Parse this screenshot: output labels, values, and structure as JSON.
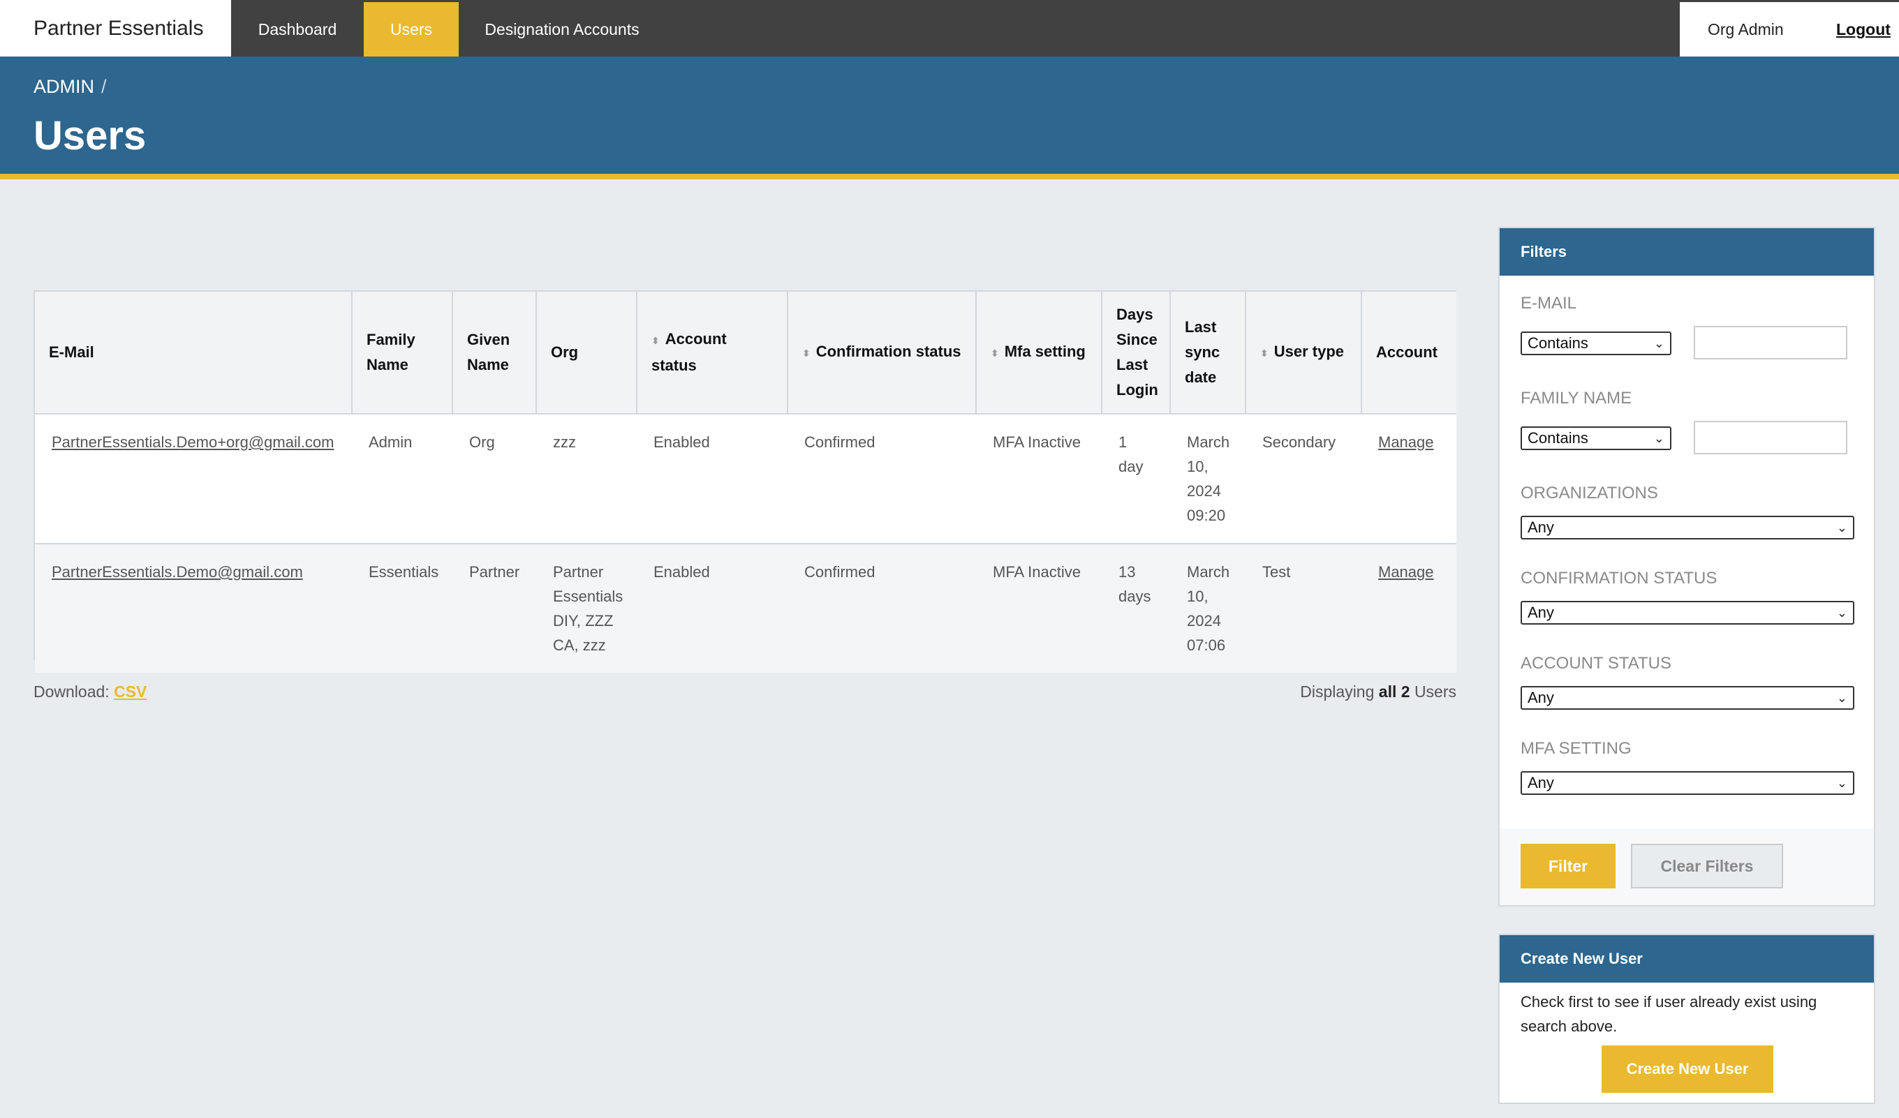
{
  "nav": {
    "brand": "Partner Essentials",
    "items": [
      {
        "label": "Dashboard"
      },
      {
        "label": "Users",
        "active": true
      },
      {
        "label": "Designation Accounts"
      }
    ],
    "org_admin": "Org Admin",
    "logout": "Logout"
  },
  "header": {
    "breadcrumb": "ADMIN",
    "breadcrumb_sep": "/",
    "title": "Users"
  },
  "table": {
    "columns": [
      {
        "label": "E-Mail",
        "sortable": false
      },
      {
        "label": "Family Name",
        "sortable": false
      },
      {
        "label": "Given Name",
        "sortable": false
      },
      {
        "label": "Org",
        "sortable": false
      },
      {
        "label": "Account status",
        "sortable": true
      },
      {
        "label": "Confirmation status",
        "sortable": true
      },
      {
        "label": "Mfa setting",
        "sortable": true
      },
      {
        "label": "Days Since Last Login",
        "sortable": false
      },
      {
        "label": "Last sync date",
        "sortable": false
      },
      {
        "label": "User type",
        "sortable": true
      },
      {
        "label": "Account",
        "sortable": false
      }
    ],
    "rows": [
      {
        "email": "PartnerEssentials.Demo+org@gmail.com",
        "family_name": "Admin",
        "given_name": "Org",
        "org": "zzz",
        "account_status": "Enabled",
        "confirmation_status": "Confirmed",
        "mfa_setting": "MFA Inactive",
        "days_since_login": "1 day",
        "last_sync": "March 10, 2024 09:20",
        "user_type": "Secondary",
        "account": "Manage"
      },
      {
        "email": "PartnerEssentials.Demo@gmail.com",
        "family_name": "Essentials",
        "given_name": "Partner",
        "org": "Partner Essentials DIY, ZZZ CA, zzz",
        "account_status": "Enabled",
        "confirmation_status": "Confirmed",
        "mfa_setting": "MFA Inactive",
        "days_since_login": "13 days",
        "last_sync": "March 10, 2024 07:06",
        "user_type": "Test",
        "account": "Manage"
      }
    ]
  },
  "footer": {
    "download_label": "Download:",
    "download_link": "CSV",
    "displaying_prefix": "Displaying",
    "displaying_count": "all 2",
    "displaying_suffix": "Users"
  },
  "filters": {
    "title": "Filters",
    "email_label": "E-MAIL",
    "email_mode": "Contains",
    "email_value": "",
    "family_label": "FAMILY NAME",
    "family_mode": "Contains",
    "family_value": "",
    "org_label": "ORGANIZATIONS",
    "org_value": "Any",
    "confirmation_label": "CONFIRMATION STATUS",
    "confirmation_value": "Any",
    "account_label": "ACCOUNT STATUS",
    "account_value": "Any",
    "mfa_label": "MFA SETTING",
    "mfa_value": "Any",
    "filter_button": "Filter",
    "clear_button": "Clear Filters"
  },
  "create_user": {
    "title": "Create New User",
    "text": "Check first to see if user already exist using search above.",
    "button": "Create New User"
  },
  "colors": {
    "nav_bg": "#414141",
    "accent": "#ebb92f",
    "banner": "#2d668e",
    "page_bg": "#e9ecef"
  }
}
